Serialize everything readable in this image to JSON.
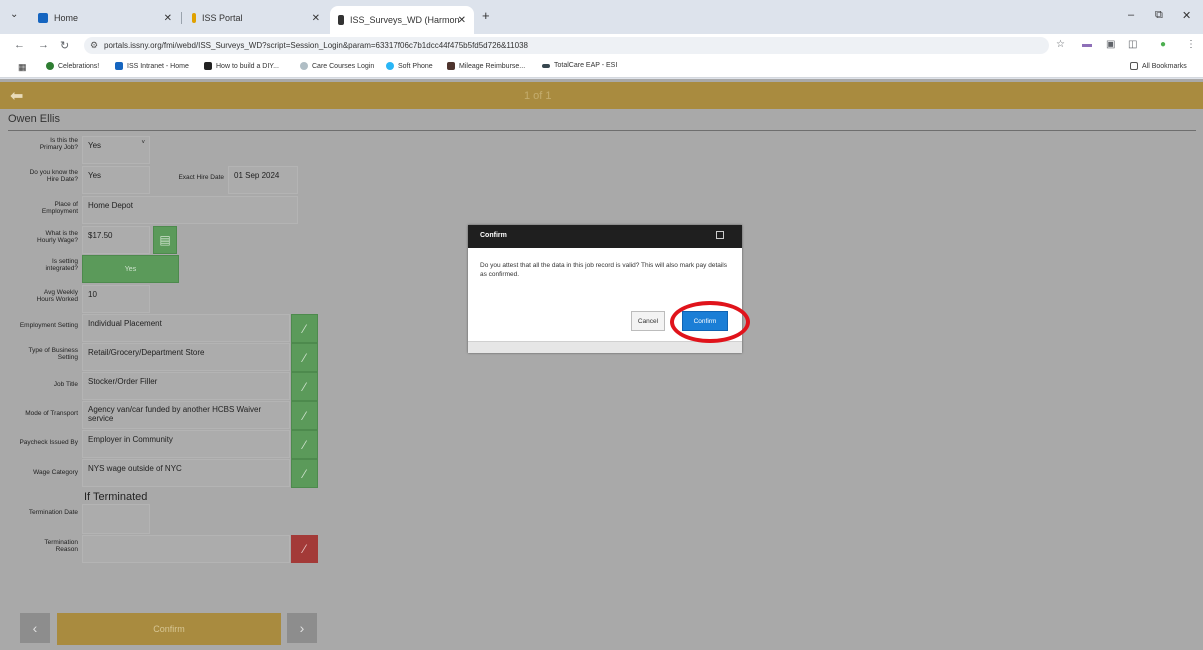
{
  "browser": {
    "tabs": [
      {
        "label": "Home",
        "color": "#1565c0"
      },
      {
        "label": "ISS Portal",
        "color": "#e0a100"
      },
      {
        "label": "ISS_Surveys_WD (Harmonie Pro",
        "color": "#333333"
      }
    ],
    "url": "portals.issny.org/fmi/webd/ISS_Surveys_WD?script=Session_Login&param=63317f06c7b1dcc44f475b5fd5d726&11038",
    "bookmarks": [
      "Celebrations!",
      "ISS Intranet - Home",
      "How to build a DIY...",
      "Care Courses Login",
      "Soft Phone",
      "Mileage Reimburse...",
      "TotalCare EAP - ESI"
    ],
    "all_bookmarks": "All Bookmarks"
  },
  "app": {
    "pager": "1 of 1",
    "person_name": "Owen Ellis",
    "fields": {
      "primary_job_label": "Is this the Primary Job?",
      "primary_job_value": "Yes",
      "know_hire_date_label": "Do you know the Hire Date?",
      "know_hire_date_value": "Yes",
      "exact_hire_date_label": "Exact Hire Date",
      "exact_hire_date_value": "01 Sep 2024",
      "place_label": "Place of Employment",
      "place_value": "Home Depot",
      "wage_label": "What is the Hourly Wage?",
      "wage_value": "$17.50",
      "integrated_label": "Is setting integrated?",
      "integrated_value": "Yes",
      "hours_label": "Avg Weekly Hours Worked",
      "hours_value": "10",
      "setting_label": "Employment Setting",
      "setting_value": "Individual Placement",
      "business_label": "Type of Business Setting",
      "business_value": "Retail/Grocery/Department Store",
      "title_label": "Job Title",
      "title_value": "Stocker/Order Filler",
      "transport_label": "Mode of Transport",
      "transport_value": "Agency van/car funded by another HCBS Waiver service",
      "paycheck_label": "Paycheck Issued By",
      "paycheck_value": "Employer in Community",
      "wage_cat_label": "Wage Category",
      "wage_cat_value": "NYS wage outside of NYC",
      "if_terminated": "If Terminated",
      "term_date_label": "Termination Date",
      "term_reason_label": "Termination Reason"
    },
    "bottom_confirm": "Confirm"
  },
  "dialog": {
    "title": "Confirm",
    "message": "Do you attest that all the data in this job record is valid? This will also mark pay details as confirmed.",
    "cancel": "Cancel",
    "confirm": "Confirm"
  }
}
